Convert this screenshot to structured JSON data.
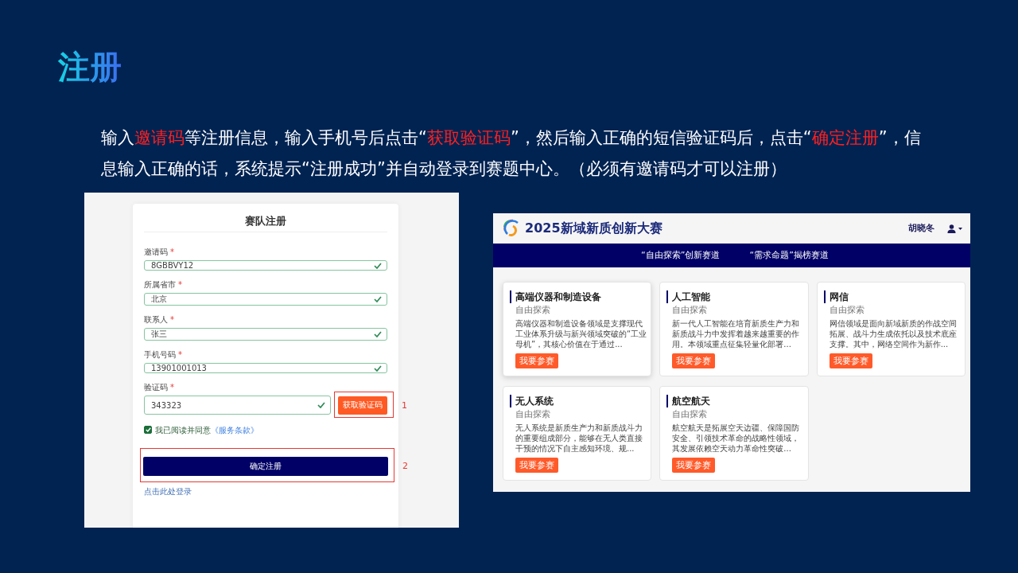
{
  "slide": {
    "title": "注册",
    "instruction": [
      {
        "text": "输入",
        "highlight": false
      },
      {
        "text": "邀请码",
        "highlight": true
      },
      {
        "text": "等注册信息，输入手机号后点击“",
        "highlight": false
      },
      {
        "text": "获取验证码",
        "highlight": true
      },
      {
        "text": "”，然后输入正确的短信验证码后，点击“",
        "highlight": false
      },
      {
        "text": "确定注册",
        "highlight": true
      },
      {
        "text": "”，信息输入正确的话，系统提示“注册成功”并自动登录到赛题中心。（必须有邀请码才可以注册）",
        "highlight": false
      }
    ]
  },
  "registration": {
    "title": "赛队注册",
    "fields": [
      {
        "kind": "text",
        "label": "邀请码",
        "required_mark": "*",
        "value": "8GBBVY12",
        "valid": true
      },
      {
        "kind": "text",
        "label": "所属省市",
        "required_mark": "*",
        "value": "北京",
        "valid": true
      },
      {
        "kind": "text",
        "label": "联系人",
        "required_mark": "*",
        "value": "张三",
        "valid": true
      },
      {
        "kind": "text",
        "label": "手机号码",
        "required_mark": "*",
        "value": "13901001013",
        "valid": true
      },
      {
        "kind": "code",
        "label": "验证码",
        "required_mark": "*",
        "value": "343323",
        "valid": true,
        "button": "获取验证码",
        "annotation": "1"
      }
    ],
    "agreement": {
      "checked": true,
      "text": "我已阅读并同意",
      "link": "《服务条款》"
    },
    "submit": {
      "label": "确定注册",
      "annotation": "2"
    },
    "login_link": "点击此处登录"
  },
  "portal": {
    "logo_text": "2025新域新质创新大赛",
    "user_name": "胡晓冬",
    "nav": [
      "“自由探索”创新赛道",
      "“需求命题”揭榜赛道"
    ],
    "cards": [
      {
        "title": "高端仪器和制造设备",
        "track": "自由探索",
        "description": "高端仪器和制造设备领域是支撑现代工业体系升级与新兴领域突破的“工业母机”，其核心价值在于通过...",
        "button": "我要参赛",
        "hovered": true
      },
      {
        "title": "人工智能",
        "track": "自由探索",
        "description": "新一代人工智能在培育新质生产力和新质战斗力中发挥着越来越重要的作用。本领域重点征集轻量化部署...",
        "button": "我要参赛",
        "hovered": false
      },
      {
        "title": "网信",
        "track": "自由探索",
        "description": "网信领域是面向新域新质的作战空间拓展、战斗力生成依托以及技术底座支撑。其中，网络空间作为新作...",
        "button": "我要参赛",
        "hovered": false
      },
      {
        "title": "无人系统",
        "track": "自由探索",
        "description": "无人系统是新质生产力和新质战斗力的重要组成部分，能够在无人类直接干预的情况下自主感知环境、规...",
        "button": "我要参赛",
        "hovered": false
      },
      {
        "title": "航空航天",
        "track": "自由探索",
        "description": "航空航天是拓展空天边疆、保障国防安全、引领技术革命的战略性领域，其发展依赖空天动力革命性突破...",
        "button": "我要参赛",
        "hovered": false
      }
    ]
  }
}
